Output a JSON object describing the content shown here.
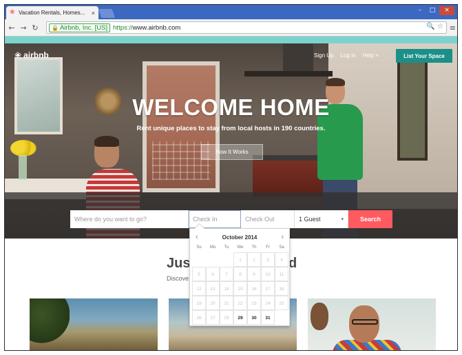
{
  "browser": {
    "tab_title": "Vacation Rentals, Homes...",
    "tab_close": "×",
    "ev_label": "Airbnb, Inc. [US]",
    "url_scheme": "https://",
    "url_rest": "www.airbnb.com",
    "window_controls": [
      "–",
      "□",
      "×"
    ]
  },
  "site": {
    "logo_text": "airbnb",
    "nav": [
      "Sign Up",
      "Log In",
      "Help ˅"
    ],
    "list_button": "List Your Space",
    "hero_title": "WELCOME HOME",
    "hero_subtitle": "Rent unique places to stay from local hosts in 190 countries.",
    "how_button": "How It Works"
  },
  "search": {
    "where_placeholder": "Where do you want to go?",
    "checkin_placeholder": "Check In",
    "checkout_placeholder": "Check Out",
    "guests_value": "1 Guest",
    "button": "Search"
  },
  "calendar": {
    "month": "October 2014",
    "prev": "‹",
    "next": "›",
    "weekdays": [
      "Su",
      "Mo",
      "Tu",
      "We",
      "Th",
      "Fr",
      "Sa"
    ],
    "days": [
      "",
      "",
      "",
      "1",
      "2",
      "3",
      "4",
      "5",
      "6",
      "7",
      "8",
      "9",
      "10",
      "11",
      "12",
      "13",
      "14",
      "15",
      "16",
      "17",
      "18",
      "19",
      "20",
      "21",
      "22",
      "23",
      "24",
      "25",
      "26",
      "27",
      "28",
      "29",
      "30",
      "31",
      ""
    ],
    "available_days": [
      "29",
      "30",
      "31"
    ]
  },
  "section": {
    "title_left": "Jus",
    "title_right": "d",
    "subtitle": "Discove"
  },
  "colors": {
    "brand": "#ff5a5f",
    "teal": "#1b8f88",
    "chrome_blue": "#3b69c2"
  }
}
